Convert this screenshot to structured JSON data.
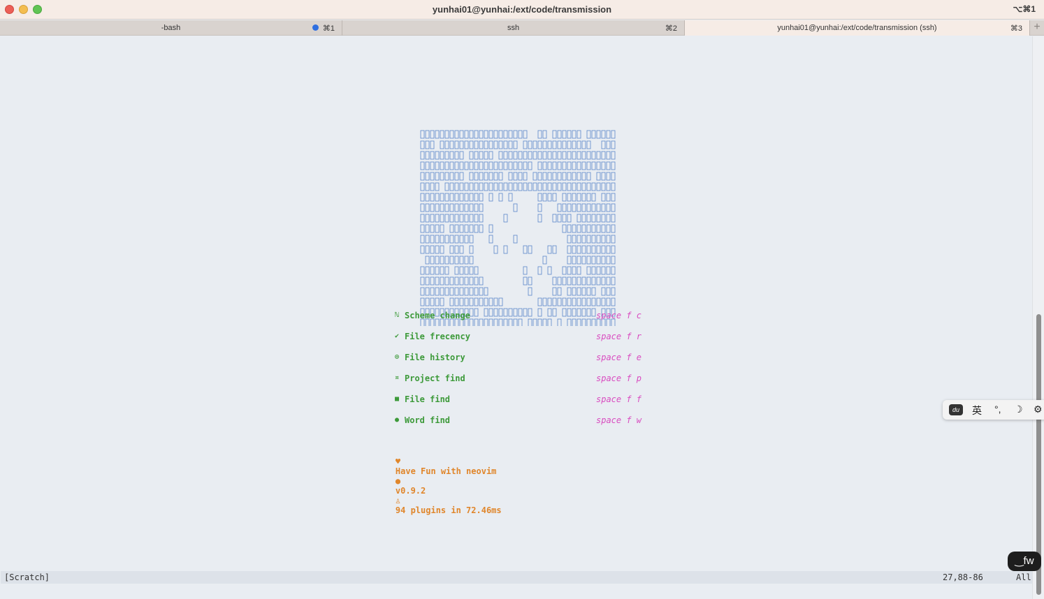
{
  "window": {
    "title": "yunhai01@yunhai:/ext/code/transmission",
    "shortcut": "⌥⌘1"
  },
  "tabs": [
    {
      "label": "-bash",
      "shortcut": "⌘1",
      "has_dot": true
    },
    {
      "label": "ssh",
      "shortcut": "⌘2"
    },
    {
      "label": "yunhai01@yunhai:/ext/code/transmission (ssh)",
      "shortcut": "⌘3",
      "active": true
    }
  ],
  "tab_add": "+",
  "dashboard": {
    "menu": [
      {
        "icon": "scheme-icon",
        "glyph": "ℕ",
        "label": "Scheme change",
        "key": "space f c"
      },
      {
        "icon": "frecency-icon",
        "glyph": "✔",
        "label": "File frecency",
        "key": "space f r"
      },
      {
        "icon": "history-icon",
        "glyph": "⊙",
        "label": "File history",
        "key": "space f e"
      },
      {
        "icon": "project-icon",
        "glyph": "¤",
        "label": "Project find",
        "key": "space f p"
      },
      {
        "icon": "file-icon",
        "glyph": "■",
        "label": "File find",
        "key": "space f f"
      },
      {
        "icon": "word-icon",
        "glyph": "●",
        "label": "Word find",
        "key": "space f w"
      }
    ],
    "footer": {
      "heart": "♥",
      "message": "Have Fun with neovim",
      "version_dot": "●",
      "version": "v0.9.2",
      "plugins_icon": "♙",
      "plugins": "94 plugins in 72.46ms"
    }
  },
  "statusline": {
    "buffer": "[Scratch]",
    "position": "27,88-86",
    "scroll": "All"
  },
  "ime_toolbar": {
    "logo": "du",
    "lang": "英",
    "punct": "°,",
    "moon": "☽",
    "settings": "⚙"
  },
  "fw_badge": "‿fw",
  "colors": {
    "menu_green": "#3d9a3a",
    "key_magenta": "#d94cc0",
    "footer_orange": "#e0862b",
    "ascii_blue": "#5a85c8"
  }
}
